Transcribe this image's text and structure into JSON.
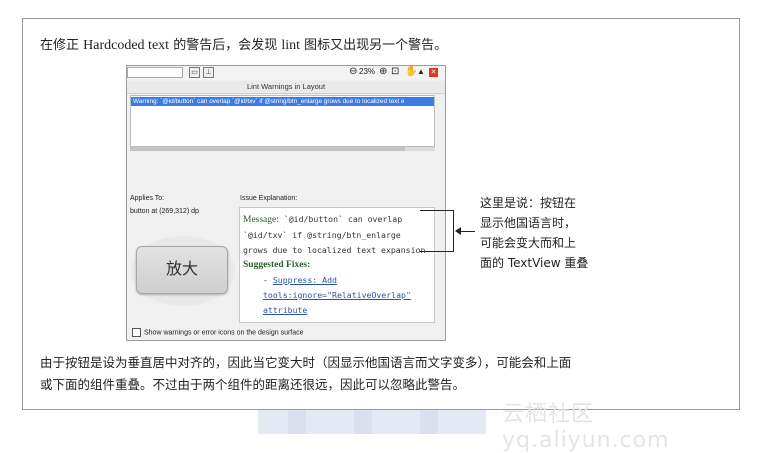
{
  "intro": {
    "prefix": "在修正 ",
    "english": "Hardcoded text",
    "middle": " 的警告后，会发现 ",
    "lint": "lint",
    "suffix": " 图标又出现另一个警告。"
  },
  "ide": {
    "toolbar": {
      "zoom": "23%",
      "btn1": "▭",
      "btn2": "⊥"
    },
    "panel_title": "Lint Warnings in Layout",
    "warning_row": "Warning: `@id/button` can overlap `@id/txv` if @string/btn_enlarge grows due to localized text e",
    "applies_to_label": "Applies To:",
    "applies_to_value": "button at (269,312) dp",
    "issue_label": "Issue Explanation:",
    "issue": {
      "message_label": "Message:",
      "line1": " `@id/button` can overlap",
      "line2": "`@id/txv` if @string/btn_enlarge",
      "line3": "grows due to localized text expansion",
      "fixes_label": "Suggested Fixes:",
      "fix_dash": "- ",
      "fix_line1": "Suppress: Add",
      "fix_line2": "tools:ignore=\"RelativeOverlap\"",
      "fix_line3": "attribute"
    },
    "preview_button": "放大",
    "show_checkbox": "Show warnings or error icons on the design surface"
  },
  "callout": {
    "line1": "这里是说：按钮在",
    "line2": "显示他国语言时，",
    "line3": "可能会变大而和上",
    "line4": "面的 TextView 重叠"
  },
  "bottom": {
    "line1": "由于按钮是设为垂直居中对齐的，因此当它变大时（因显示他国语言而文字变多），可能会和上面",
    "line2": "或下面的组件重叠。不过由于两个组件的距离还很远，因此可以忽略此警告。"
  },
  "watermark": "云栖社区 yq.aliyun.com"
}
